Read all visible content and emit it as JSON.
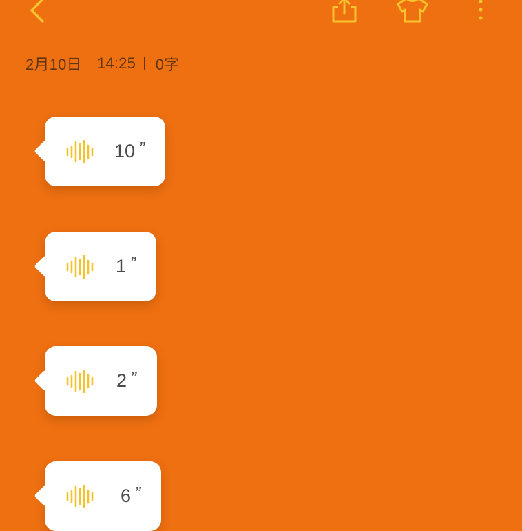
{
  "toolbar": {
    "accent_color": "#F7C32E",
    "icons": [
      "chevron-left-icon",
      "share-icon",
      "shirt-icon",
      "more-vertical-icon"
    ]
  },
  "meta": {
    "date": "2月10日",
    "time": "14:25",
    "word_count": "0字"
  },
  "voice_notes": [
    {
      "duration": "10"
    },
    {
      "duration": "1"
    },
    {
      "duration": "2"
    },
    {
      "duration": "6"
    }
  ],
  "colors": {
    "background": "#EE7011",
    "bubble": "#FFFFFF",
    "wave": "#F5C22B",
    "text": "#4A4A4A"
  }
}
